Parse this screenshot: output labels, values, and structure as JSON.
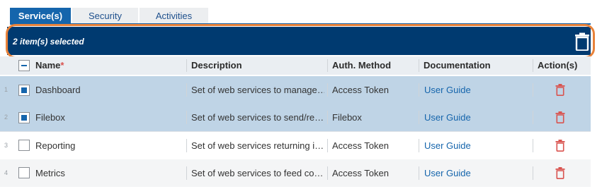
{
  "tabs": [
    {
      "label": "Service(s)",
      "active": true
    },
    {
      "label": "Security",
      "active": false
    },
    {
      "label": "Activities",
      "active": false
    }
  ],
  "selection_bar": {
    "text": "2 item(s) selected",
    "delete_icon": "trash-icon"
  },
  "table": {
    "columns": [
      {
        "label": "Name",
        "required_marker": "*"
      },
      {
        "label": "Description"
      },
      {
        "label": "Auth. Method"
      },
      {
        "label": "Documentation"
      },
      {
        "label": "Action(s)"
      }
    ],
    "rows": [
      {
        "num": "1",
        "selected": true,
        "name": "Dashboard",
        "description": "Set of web services to manage…",
        "auth": "Access Token",
        "doc": "User Guide"
      },
      {
        "num": "2",
        "selected": true,
        "name": "Filebox",
        "description": "Set of web services to send/re…",
        "auth": "Filebox",
        "doc": "User Guide"
      },
      {
        "num": "3",
        "selected": false,
        "name": "Reporting",
        "description": "Set of web services returning i…",
        "auth": "Access Token",
        "doc": "User Guide"
      },
      {
        "num": "4",
        "selected": false,
        "name": "Metrics",
        "description": "Set of web services to feed co…",
        "auth": "Access Token",
        "doc": "User Guide"
      }
    ]
  },
  "colors": {
    "accent": "#1565ac",
    "selection_bar": "#003a70",
    "selected_row": "#bfd4e6",
    "delete": "#d9534f",
    "highlight_outline": "#e8823a"
  }
}
